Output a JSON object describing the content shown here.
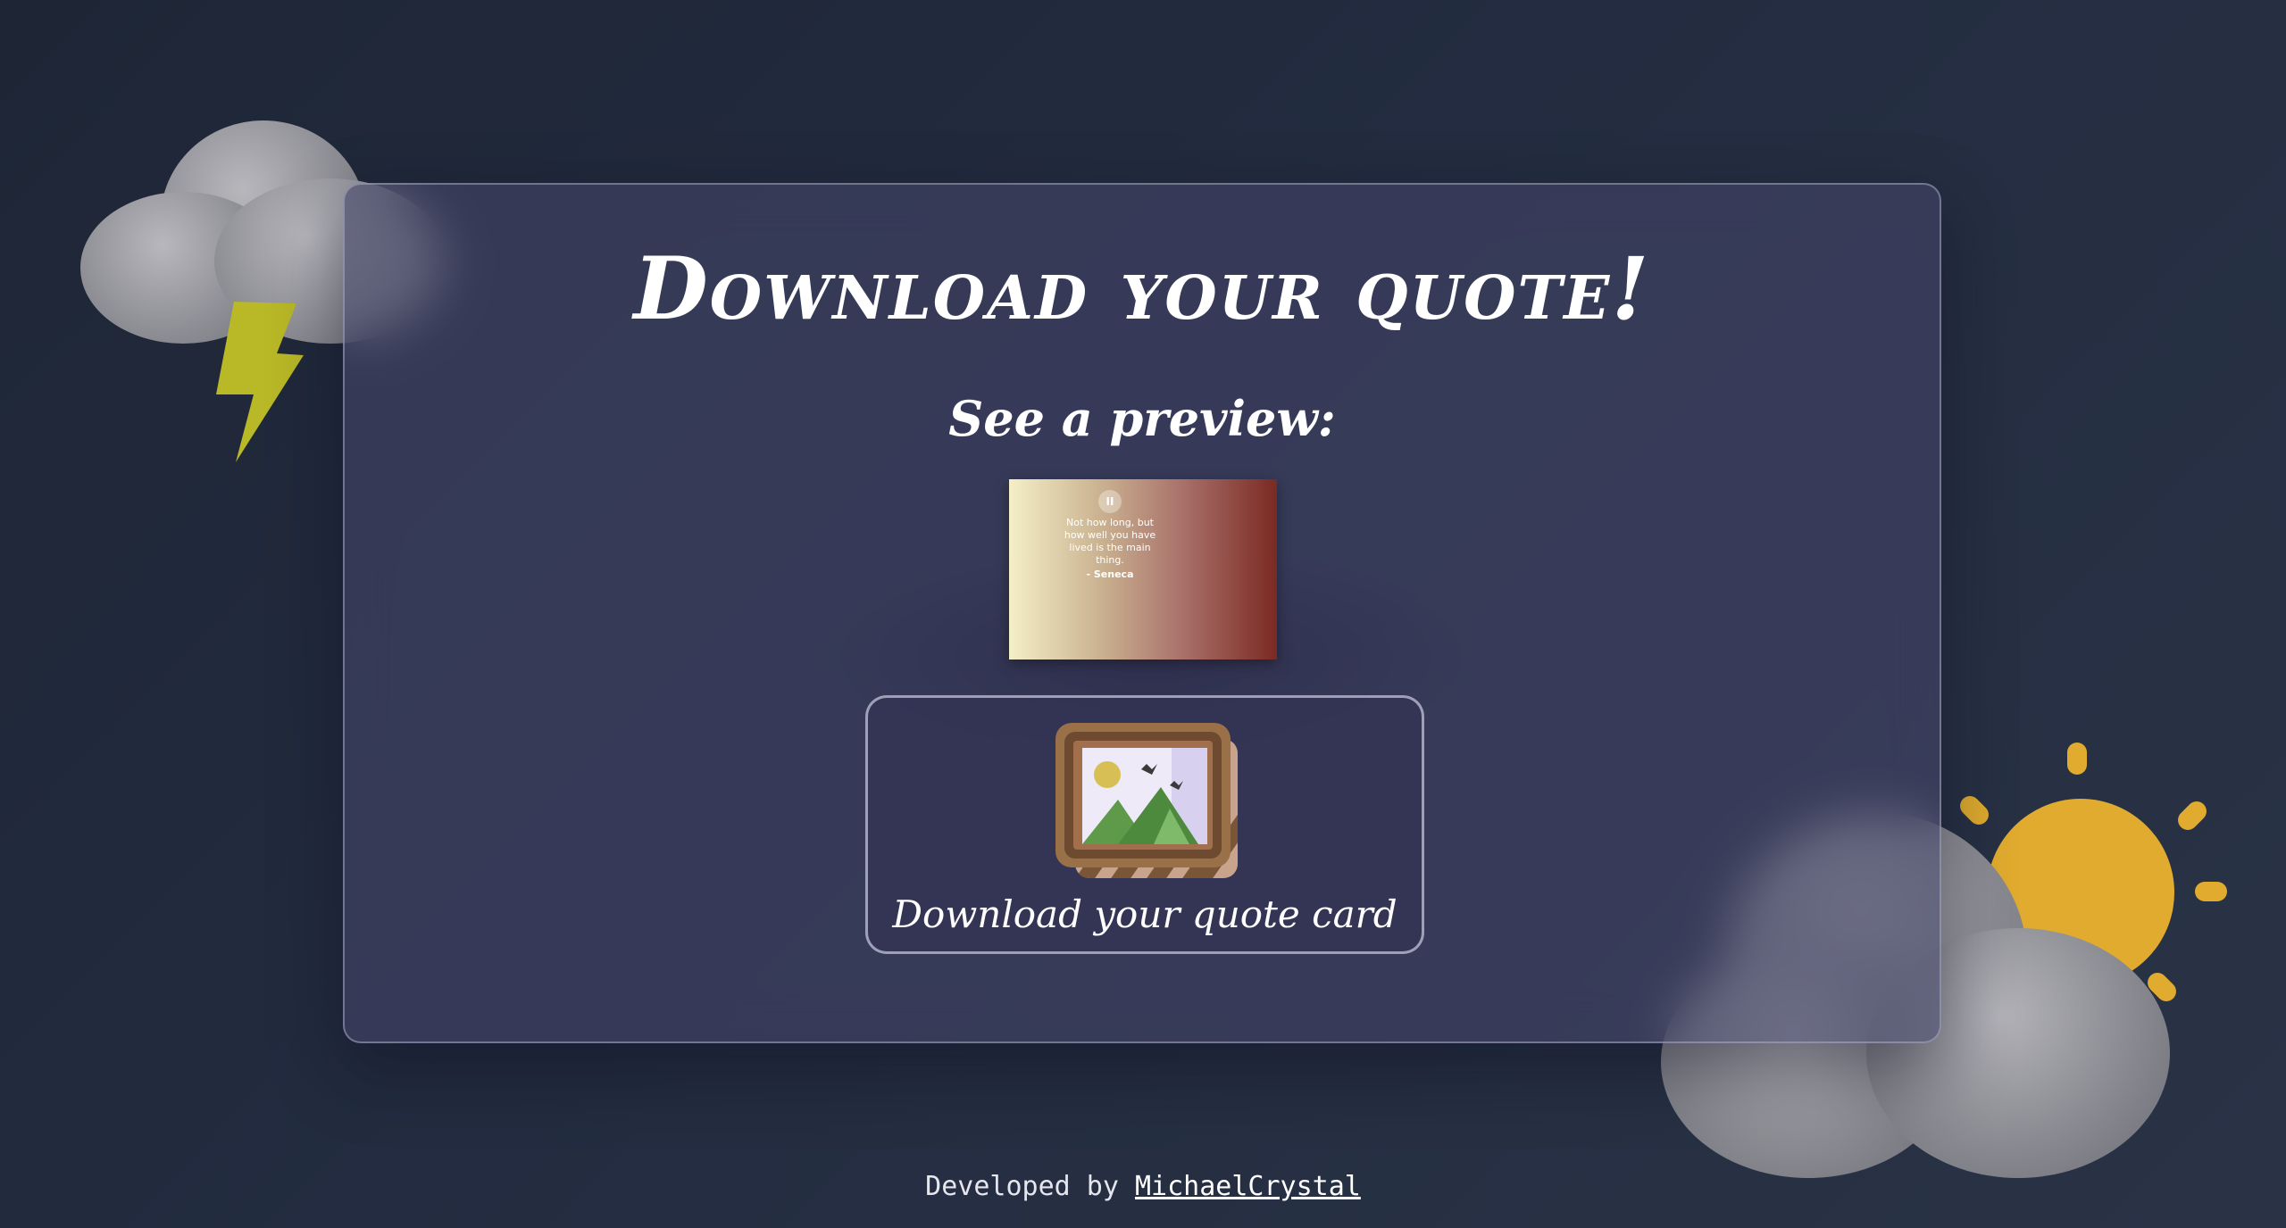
{
  "page": {
    "title": "Download your quote!",
    "preview_heading": "See a preview:"
  },
  "preview_card": {
    "quote": "Not how long, but how well you have lived is the main thing.",
    "author": "- Seneca",
    "pause_symbol": "II",
    "gradient_colors": [
      "#f4efc6",
      "#c9b08f",
      "#a9706a",
      "#7a2a22"
    ]
  },
  "download_button": {
    "label": "Download your quote card",
    "icon": "picture-frame-icon"
  },
  "footer": {
    "prefix": "Developed by",
    "author_link": "MichaelCrystal"
  },
  "decorations": {
    "top_left": "storm-cloud-icon",
    "bottom_right": "sun-behind-cloud-icon"
  },
  "colors": {
    "background": "#232c40",
    "panel": "#424468",
    "lightning": "#b9b827",
    "sun": "#e0ab2e"
  }
}
